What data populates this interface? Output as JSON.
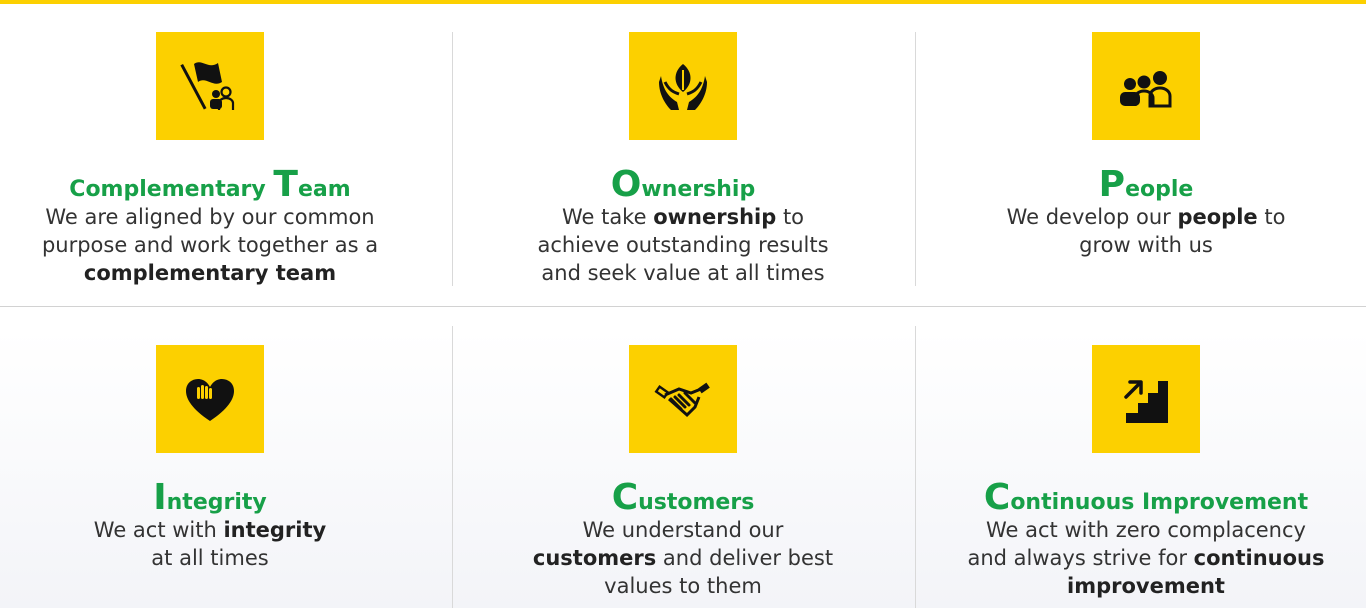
{
  "colors": {
    "accent_yellow": "#fcd000",
    "title_green": "#17a048",
    "text": "#333333"
  },
  "values": [
    {
      "icon": "flag-team-icon",
      "title_initial": "T",
      "title_prefix": "Complementary ",
      "title_rest": "eam",
      "lines": [
        [
          {
            "t": "We are aligned by our common",
            "b": false
          }
        ],
        [
          {
            "t": "purpose and work together as a",
            "b": false
          }
        ],
        [
          {
            "t": "complementary team",
            "b": true
          }
        ]
      ]
    },
    {
      "icon": "hands-leaf-icon",
      "title_initial": "O",
      "title_prefix": "",
      "title_rest": "wnership",
      "lines": [
        [
          {
            "t": "We take ",
            "b": false
          },
          {
            "t": "ownership",
            "b": true
          },
          {
            "t": " to",
            "b": false
          }
        ],
        [
          {
            "t": "achieve outstanding results",
            "b": false
          }
        ],
        [
          {
            "t": "and seek value at all times",
            "b": false
          }
        ]
      ]
    },
    {
      "icon": "people-group-icon",
      "title_initial": "P",
      "title_prefix": "",
      "title_rest": "eople",
      "lines": [
        [
          {
            "t": "We develop our ",
            "b": false
          },
          {
            "t": "people",
            "b": true
          },
          {
            "t": " to",
            "b": false
          }
        ],
        [
          {
            "t": "grow with us",
            "b": false
          }
        ]
      ]
    },
    {
      "icon": "heart-hand-icon",
      "title_initial": "I",
      "title_prefix": "",
      "title_rest": "ntegrity",
      "lines": [
        [
          {
            "t": "We act with ",
            "b": false
          },
          {
            "t": "integrity",
            "b": true
          }
        ],
        [
          {
            "t": "at all times",
            "b": false
          }
        ]
      ]
    },
    {
      "icon": "handshake-icon",
      "title_initial": "C",
      "title_prefix": "",
      "title_rest": "ustomers",
      "lines": [
        [
          {
            "t": "We understand our",
            "b": false
          }
        ],
        [
          {
            "t": "customers",
            "b": true
          },
          {
            "t": " and deliver best",
            "b": false
          }
        ],
        [
          {
            "t": "values to them",
            "b": false
          }
        ]
      ]
    },
    {
      "icon": "stairs-arrow-icon",
      "title_initial": "C",
      "title_prefix": "",
      "title_rest": "ontinuous Improvement",
      "lines": [
        [
          {
            "t": "We act with zero complacency",
            "b": false
          }
        ],
        [
          {
            "t": "and always strive for ",
            "b": false
          },
          {
            "t": "continuous",
            "b": true
          }
        ],
        [
          {
            "t": "improvement",
            "b": true
          }
        ]
      ]
    }
  ]
}
